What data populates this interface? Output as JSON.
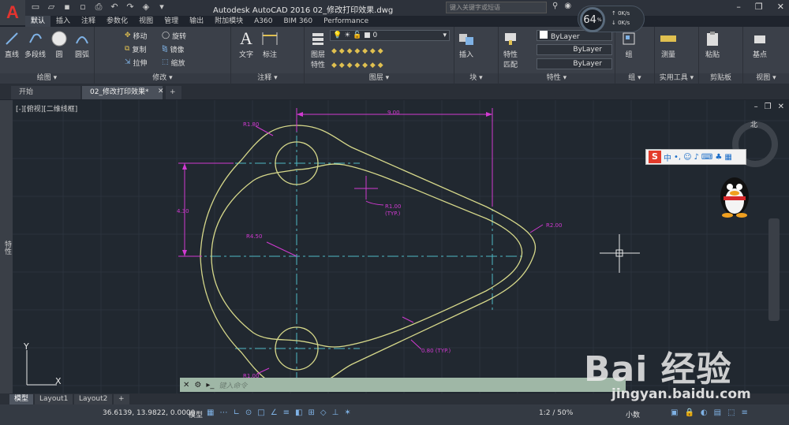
{
  "app": {
    "title": "Autodesk AutoCAD 2016    02_修改打印效果.dwg",
    "search_placeholder": "键入关键字或短语",
    "logo_letter": "A"
  },
  "network_widget": {
    "percent": "64",
    "unit": "%",
    "up": "0K/s",
    "down": "0K/s"
  },
  "ribbon_tabs": [
    "默认",
    "插入",
    "注释",
    "参数化",
    "视图",
    "管理",
    "输出",
    "附加模块",
    "A360",
    "BIM 360",
    "Performance"
  ],
  "ribbon": {
    "draw": {
      "footer": "绘图 ▾",
      "tools": [
        "直线",
        "多段线",
        "圆",
        "圆弧"
      ]
    },
    "modify": {
      "footer": "修改 ▾",
      "rows": [
        [
          "移动",
          "旋转"
        ],
        [
          "复制",
          "镜像"
        ],
        [
          "拉伸",
          "缩放"
        ]
      ]
    },
    "annotation": {
      "footer": "注释 ▾",
      "tools": [
        "文字",
        "标注"
      ]
    },
    "layers": {
      "footer": "图层 ▾",
      "tool": "图层\n特性",
      "current_layer": "0"
    },
    "block": {
      "footer": "块 ▾",
      "tool": "插入"
    },
    "properties": {
      "footer": "特性 ▾",
      "tool": "特性\n匹配",
      "color": "ByLayer",
      "linetype": "ByLayer",
      "lineweight": "ByLayer"
    },
    "groups": {
      "footer": "组 ▾",
      "tool": "组"
    },
    "utilities": {
      "footer": "实用工具 ▾",
      "tool": "测量"
    },
    "clipboard": {
      "footer": "剪贴板",
      "tool": "粘贴"
    },
    "view": {
      "footer": "视图 ▾",
      "tool": "基点"
    }
  },
  "doc_tabs": {
    "start": "开始",
    "active": "02_修改打印效果*",
    "add": "+"
  },
  "viewport": {
    "label": "[-][俯视][二维线框]",
    "left_strip": "特性",
    "ucs_x": "X",
    "ucs_y": "Y",
    "navcube_label": "北"
  },
  "drawing": {
    "dims": {
      "top": "9.00",
      "left": "4.30",
      "r180": "R1.80",
      "r100": "R1.00",
      "typ1": "(TYP.)",
      "r200": "R2.00",
      "r450": "R4.50",
      "d080": "0.80 (TYP.)",
      "r100b": "R1.00"
    },
    "colors": {
      "outline": "#d6d88a",
      "dims": "#d13ad1",
      "center": "#4fb8c4"
    }
  },
  "command_line": {
    "placeholder": "键入命令"
  },
  "layout_tabs": [
    "模型",
    "Layout1",
    "Layout2",
    "+"
  ],
  "status": {
    "coords": "36.6139, 13.9822, 0.0000",
    "model": "模型",
    "scale": "1:2 / 50%",
    "units": "小数"
  },
  "watermark": {
    "brand": "Bai 经验",
    "url": "jingyan.baidu.com"
  },
  "ime": {
    "logo": "S",
    "mode": "中"
  }
}
